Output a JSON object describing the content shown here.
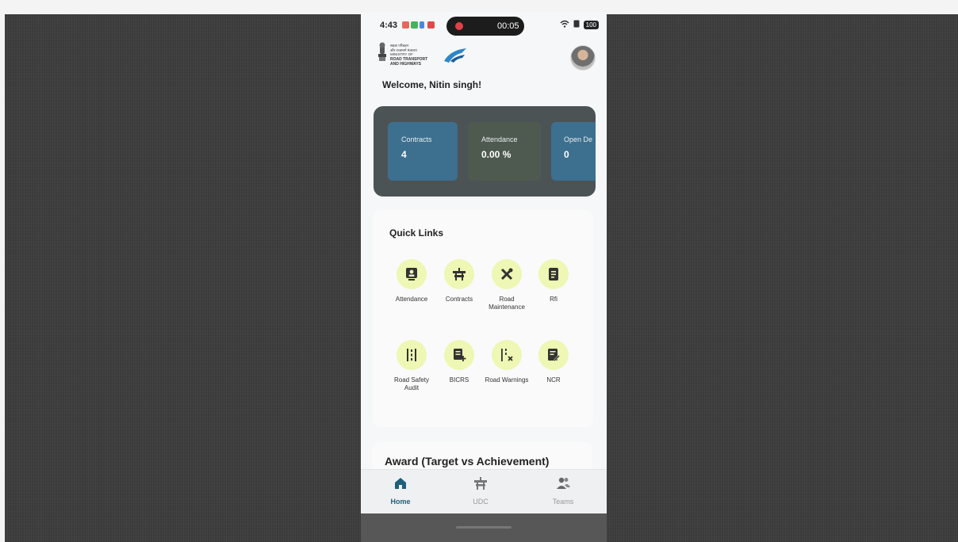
{
  "status_bar": {
    "time": "4:43",
    "recording_timer": "00:05",
    "battery": "100"
  },
  "header": {
    "ministry_lines": [
      "सड़क परिवहन",
      "और राजमार्ग मंत्रालय",
      "MINISTRY OF"
    ],
    "ministry_name_1": "ROAD TRANSPORT",
    "ministry_name_2": "AND HIGHWAYS"
  },
  "welcome_text": "Welcome, Nitin singh!",
  "stats": [
    {
      "label": "Contracts",
      "value": "4"
    },
    {
      "label": "Attendance",
      "value": "0.00 %"
    },
    {
      "label": "Open De",
      "value": "0"
    }
  ],
  "quick_links": {
    "title": "Quick Links",
    "items": [
      {
        "label": "Attendance",
        "icon": "attendance-icon"
      },
      {
        "label": "Contracts",
        "icon": "road-barrier-icon"
      },
      {
        "label": "Road Maintenance",
        "icon": "tools-icon"
      },
      {
        "label": "Rfi",
        "icon": "document-icon"
      },
      {
        "label": "Road Safety Audit",
        "icon": "road-lanes-icon"
      },
      {
        "label": "BICRS",
        "icon": "document-plus-icon"
      },
      {
        "label": "Road Warnings",
        "icon": "road-warning-icon"
      },
      {
        "label": "NCR",
        "icon": "document-edit-icon"
      }
    ]
  },
  "award": {
    "title": "Award (Target vs Achievement)"
  },
  "bottom_nav": {
    "items": [
      {
        "label": "Home",
        "icon": "home-icon",
        "active": true
      },
      {
        "label": "UDC",
        "icon": "road-barrier-icon",
        "active": false
      },
      {
        "label": "Teams",
        "icon": "team-icon",
        "active": false
      }
    ]
  },
  "colors": {
    "stats_bg": "#4b5355",
    "stat_tile_blue": "#3d6f8f",
    "quick_link_circle": "#eef7b3",
    "active_tab": "#1f5f7a"
  }
}
